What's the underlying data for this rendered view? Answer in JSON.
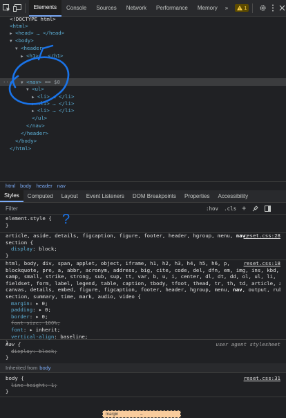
{
  "topbar": {
    "tabs": [
      "Elements",
      "Console",
      "Sources",
      "Network",
      "Performance",
      "Memory"
    ],
    "more": "»",
    "warnings": "1",
    "icons": [
      "inspect-icon",
      "device-toggle-icon",
      "gear-icon",
      "kebab-menu-icon",
      "close-icon"
    ]
  },
  "dom": {
    "doctype": "<!DOCTYPE html>",
    "html_open": "<html>",
    "head_line": "<head> … </head>",
    "body_open": "<body>",
    "header_open": "<header>",
    "h1_line": "<h1> … </h1>",
    "nav_open": "<nav>",
    "nav_suffix": "== $0",
    "ul_open": "<ul>",
    "li_line": "<li> … </li>",
    "ul_close": "</ul>",
    "nav_close": "</nav>",
    "header_close": "</header>",
    "body_close": "</body>",
    "html_close": "</html>",
    "row_dots": "···",
    "annotation_color": "#1a73e8"
  },
  "breadcrumb": [
    "html",
    "body",
    "header",
    "nav"
  ],
  "subtabs": [
    "Styles",
    "Computed",
    "Layout",
    "Event Listeners",
    "DOM Breakpoints",
    "Properties",
    "Accessibility"
  ],
  "filter": {
    "placeholder": "Filter",
    "hov": ":hov",
    "cls": ".cls",
    "plus": "+"
  },
  "styles": {
    "element_style": {
      "selector": "element.style {",
      "close": "}",
      "question_mark": "?"
    },
    "reset1": {
      "source": "reset.css:28",
      "line1": "article, aside, details, figcaption, figure, footer, header, hgroup, menu, ",
      "match": "nav",
      "line1_end": ",",
      "line2": "section {",
      "decl": {
        "prop": "display",
        "value": "block;"
      },
      "close": "}"
    },
    "reset2": {
      "source": "reset.css:18",
      "lines": [
        "html, body, div, span, applet, object, iframe, h1, h2, h3, h4, h5, h6, p,",
        "blockquote, pre, a, abbr, acronym, address, big, cite, code, del, dfn, em, img, ins, kbd, q, s,",
        "samp, small, strike, strong, sub, sup, tt, var, b, u, i, center, dl, dt, dd, ol, ul, li,",
        "fieldset, form, label, legend, table, caption, tbody, tfoot, thead, tr, th, td, article, aside,",
        "canvas, details, embed, figure, figcaption, footer, header, hgroup, menu, "
      ],
      "match": "nav",
      "last_end": ", output, ruby,",
      "line_last": "section, summary, time, mark, audio, video {",
      "decls": [
        {
          "prop": "margin",
          "value": "▸ 0;",
          "struck": false
        },
        {
          "prop": "padding",
          "value": "▸ 0;",
          "struck": false
        },
        {
          "prop": "border",
          "value": "▸ 0;",
          "struck": false
        },
        {
          "prop": "font-size",
          "value": "100%;",
          "struck": true
        },
        {
          "prop": "font",
          "value": "▸ inherit;",
          "struck": false
        },
        {
          "prop": "vertical-align",
          "value": "baseline;",
          "struck": false
        }
      ],
      "close": "}"
    },
    "ua": {
      "selector": "nav {",
      "source": "user agent stylesheet",
      "decl": "display: block;",
      "close": "}"
    },
    "inherited": {
      "label": "Inherited from",
      "target": "body"
    },
    "body_rule": {
      "selector": "body {",
      "source": "reset.css:31",
      "decl": "line-height: 1;",
      "close": "}"
    },
    "box_model": {
      "label": "margin",
      "value": "–"
    }
  }
}
